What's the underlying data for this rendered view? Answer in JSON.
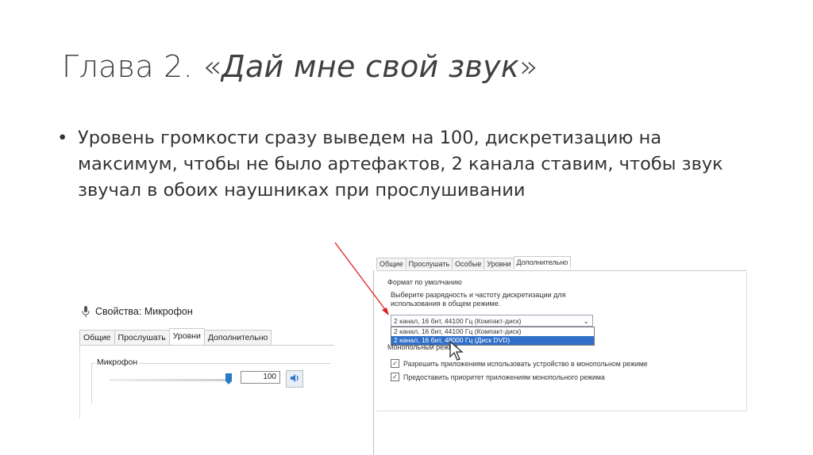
{
  "slide": {
    "title_prefix": "Глава 2. «",
    "title_italic": "Дай мне свой звук",
    "title_suffix": "»",
    "bullet": "Уровень громкости сразу выведем на 100, дискретизацию на максимум, чтобы не было артефактов, 2 канала ставим, чтобы звук звучал в обоих наушниках при прослушивании"
  },
  "mic_dialog": {
    "title": "Свойства: Микрофон",
    "icon": "microphone-icon",
    "tabs": [
      "Общие",
      "Прослушать",
      "Уровни",
      "Дополнительно"
    ],
    "active_tab": "Уровни",
    "group_label": "Микрофон",
    "volume_value": "100",
    "volume_level_percent": 100,
    "speaker_icon": "speaker-icon"
  },
  "advanced_dialog": {
    "tabs": [
      "Общие",
      "Прослушать",
      "Особые",
      "Уровни",
      "Дополнительно"
    ],
    "active_tab": "Дополнительно",
    "default_format_label": "Формат по умолчанию",
    "default_format_desc_line1": "Выберите разрядность и частоту дискретизации для",
    "default_format_desc_line2": "использования в общем режиме.",
    "combo_value": "2 канал, 16 бит, 44100 Гц (Компакт-диск)",
    "dropdown_options": [
      "2 канал, 16 бит, 44100 Гц (Компакт-диск)",
      "2 канал, 16 бит, 48000 Гц (Диск DVD)"
    ],
    "selected_option_index": 1,
    "exclusive_label": "Монопольный режим",
    "check1": "Разрешить приложениям использовать устройство в монопольном режиме",
    "check2": "Предоставить приоритет приложениям монопольного режима"
  },
  "colors": {
    "arrow": "#e02020",
    "selection": "#2f6fc9",
    "thumb": "#2b78c5"
  }
}
